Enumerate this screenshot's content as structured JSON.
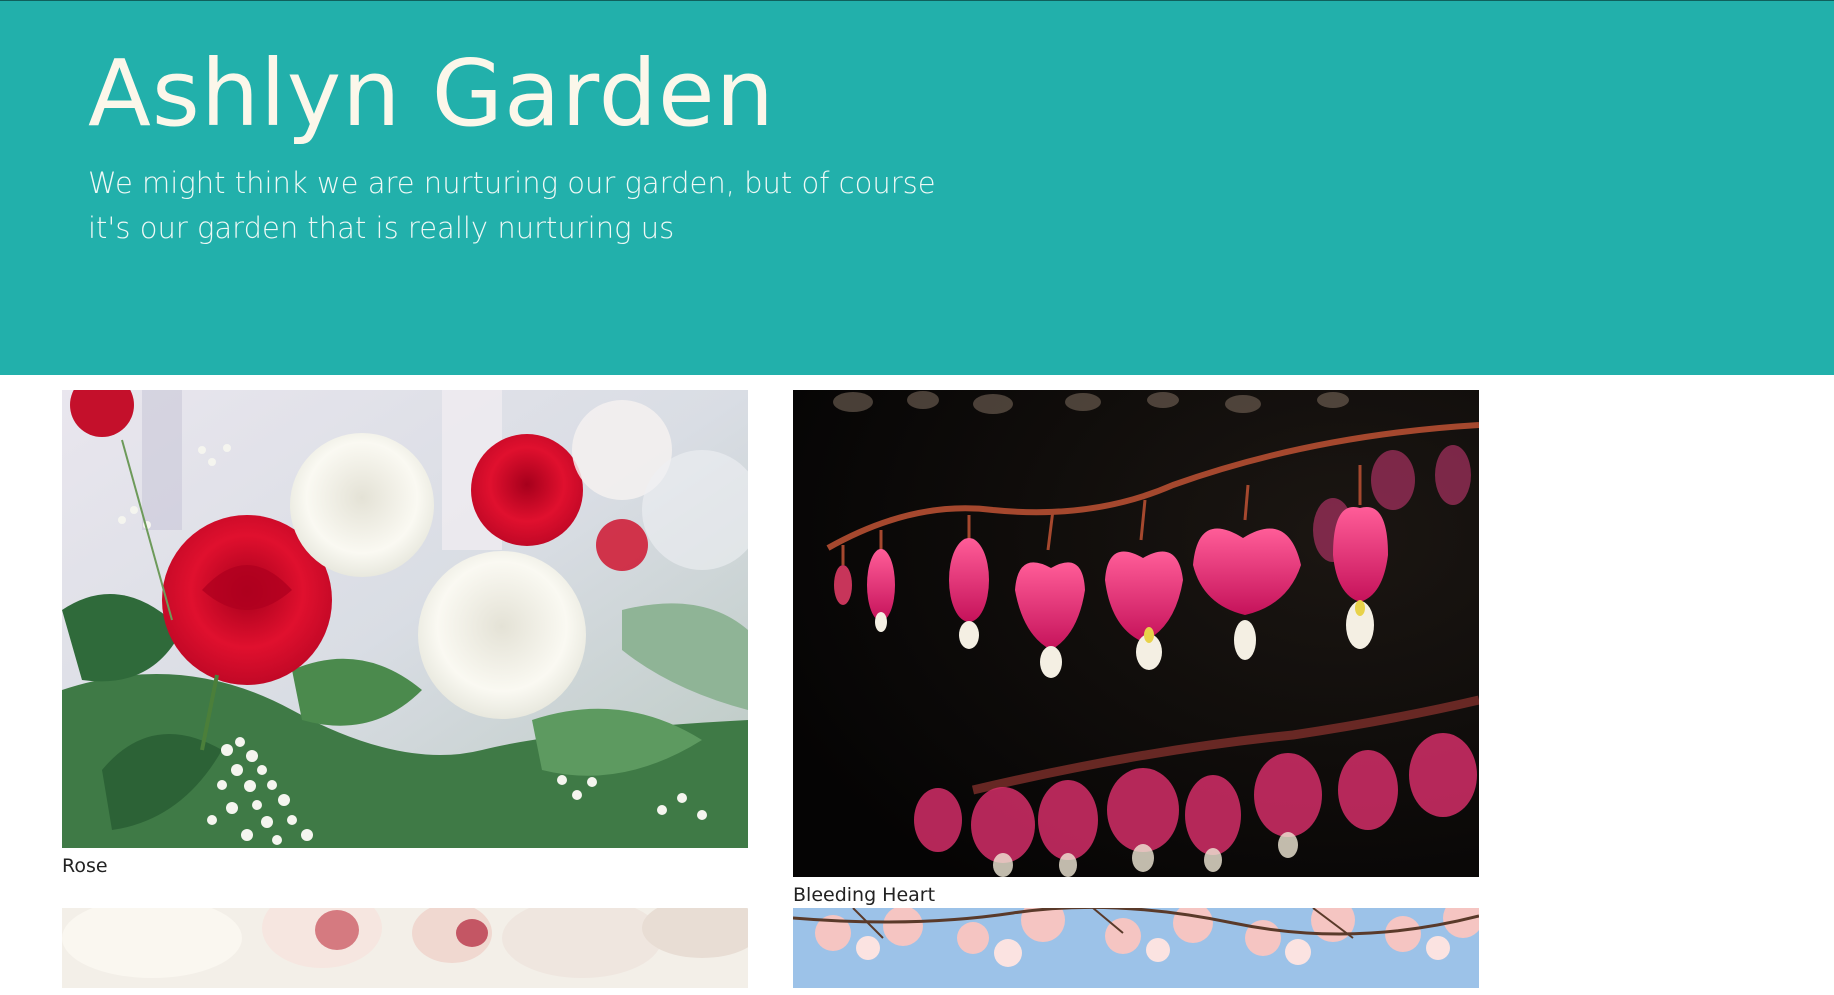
{
  "header": {
    "title": "Ashlyn Garden",
    "tagline": "We might think we are nurturing our garden, but of course it's our garden that is really nurturing us"
  },
  "gallery": {
    "items": [
      {
        "caption": "Rose",
        "image": "rose-photo"
      },
      {
        "caption": "Bleeding Heart",
        "image": "bleeding-heart-photo"
      },
      {
        "caption": "",
        "image": "orchid-photo"
      },
      {
        "caption": "",
        "image": "cherry-blossom-photo"
      }
    ]
  },
  "colors": {
    "header_background": "#22b0ab",
    "header_text": "#fbf7ea",
    "caption_text": "#222222"
  }
}
